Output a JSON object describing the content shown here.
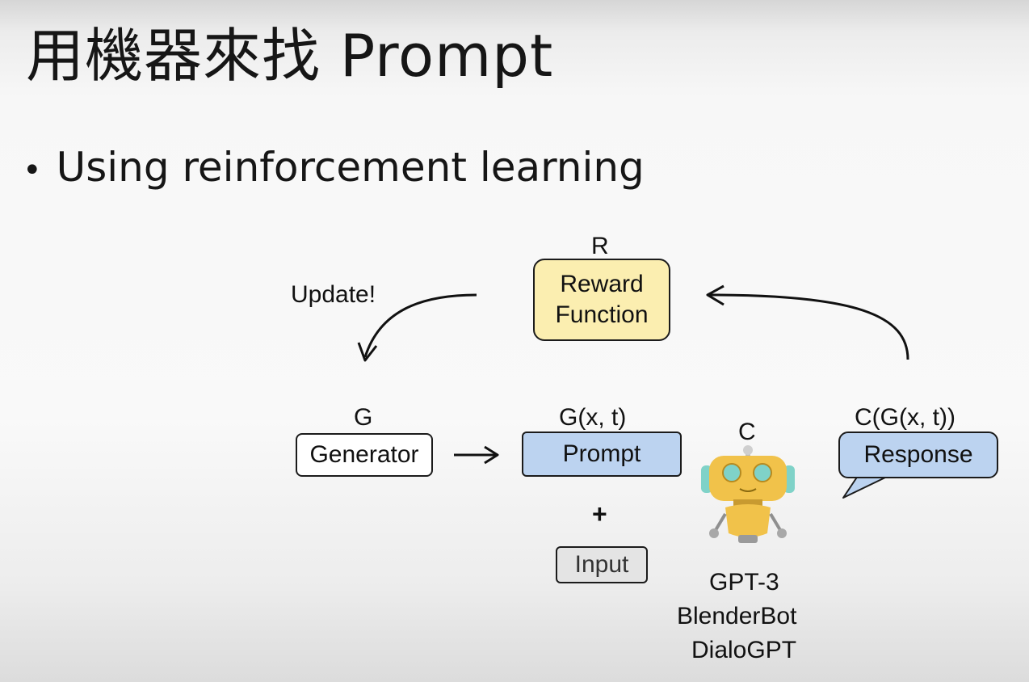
{
  "slide": {
    "title": "用機器來找 Prompt",
    "bullet": "Using reinforcement learning"
  },
  "diagram": {
    "reward": {
      "tag": "R",
      "line1": "Reward",
      "line2": "Function"
    },
    "update_label": "Update!",
    "generator": {
      "tag": "G",
      "label": "Generator"
    },
    "prompt": {
      "tag": "G(x, t)",
      "label": "Prompt"
    },
    "plus": "+",
    "input": {
      "label": "Input"
    },
    "chatbot": {
      "tag": "C",
      "models": [
        "GPT-3",
        "BlenderBot",
        "DialoGPT"
      ]
    },
    "response": {
      "tag": "C(G(x, t))",
      "label": "Response"
    }
  },
  "colors": {
    "reward_fill": "#fbeeb0",
    "prompt_fill": "#bcd3f0",
    "response_fill": "#bcd3f0",
    "input_fill": "#e4e4e4",
    "robot_body": "#f1c24a",
    "robot_accent": "#7fd2c8"
  }
}
